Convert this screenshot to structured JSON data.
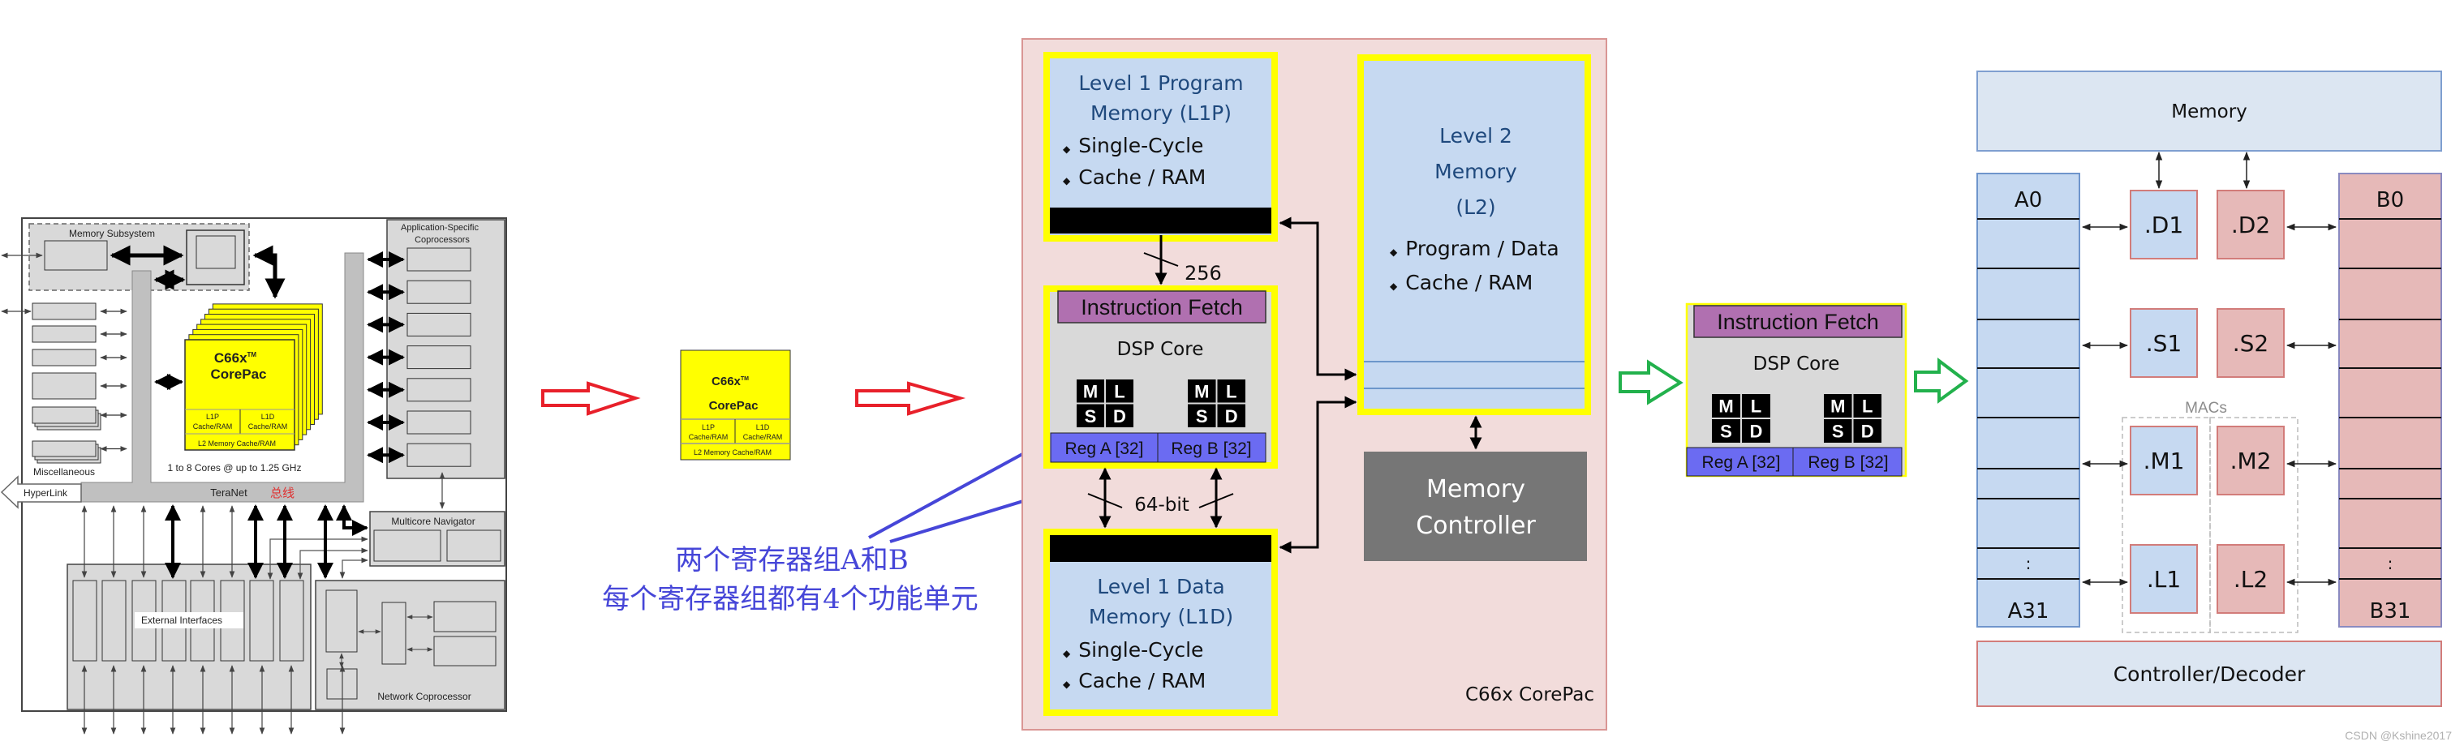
{
  "soc": {
    "memory_subsystem": "Memory Subsystem",
    "app_coprocessors": [
      "Application-Specific",
      "Coprocessors"
    ],
    "corepac_name": "C66x",
    "tm": "TM",
    "corepac": "CorePac",
    "l1p": [
      "L1P",
      "Cache/RAM"
    ],
    "l1d": [
      "L1D",
      "Cache/RAM"
    ],
    "l2": "L2 Memory Cache/RAM",
    "cores": "1 to 8 Cores @ up to 1.25 GHz",
    "misc": "Miscellaneous",
    "hyperlink": "HyperLink",
    "teranet": "TeraNet",
    "bus_note": "总线",
    "navigator": "Multicore Navigator",
    "external": "External Interfaces",
    "network": "Network Coprocessor"
  },
  "small_corepac": {
    "name": "C66x",
    "tm": "TM",
    "corepac": "CorePac",
    "l1p": [
      "L1P",
      "Cache/RAM"
    ],
    "l1d": [
      "L1D",
      "Cache/RAM"
    ],
    "l2": "L2 Memory Cache/RAM"
  },
  "annotation": {
    "line1": "两个寄存器组A和B",
    "line2": "每个寄存器组都有4个功能单元"
  },
  "corepac_detail": {
    "l1p": {
      "title": [
        "Level 1 Program",
        "Memory (L1P)"
      ],
      "bullets": [
        "Single-Cycle",
        "Cache / RAM"
      ]
    },
    "bus_256": "256",
    "bus_64": "64-bit",
    "l1d": {
      "title": [
        "Level 1 Data",
        "Memory (L1D)"
      ],
      "bullets": [
        "Single-Cycle",
        "Cache / RAM"
      ]
    },
    "l2": {
      "title": [
        "Level 2",
        "Memory",
        "(L2)"
      ],
      "bullets": [
        "Program / Data",
        "Cache / RAM"
      ]
    },
    "mem_ctrl": [
      "Memory",
      "Controller"
    ],
    "label": "C66x CorePac",
    "bullet": "◆"
  },
  "dsp_core": {
    "fetch": "Instruction Fetch",
    "title": "DSP Core",
    "units": [
      "M",
      "L",
      "S",
      "D"
    ],
    "reg_a": "Reg A [32]",
    "reg_b": "Reg B [32]"
  },
  "datapath": {
    "memory": "Memory",
    "a_first": "A0",
    "a_last": "A31",
    "b_first": "B0",
    "b_last": "B31",
    "ellipsis": ":",
    "units_a": [
      ".D1",
      ".S1",
      ".M1",
      ".L1"
    ],
    "units_b": [
      ".D2",
      ".S2",
      ".M2",
      ".L2"
    ],
    "macs": "MACs",
    "controller": "Controller/Decoder"
  },
  "watermark": "CSDN @Kshine2017",
  "colors": {
    "corepac_yellow": "#ffff00",
    "corepac_bg": "#f2dcdb",
    "memory_blue": "#c6d9f1",
    "reg_blue": "#6b6bf2",
    "fetch_purple": "#b070b0",
    "mem_ctrl_gray": "#767676",
    "red_arrow": "#e8202a",
    "green_arrow": "#22b14c",
    "annotation_blue": "#4646d8",
    "unit_red": "#e6b9b8"
  }
}
